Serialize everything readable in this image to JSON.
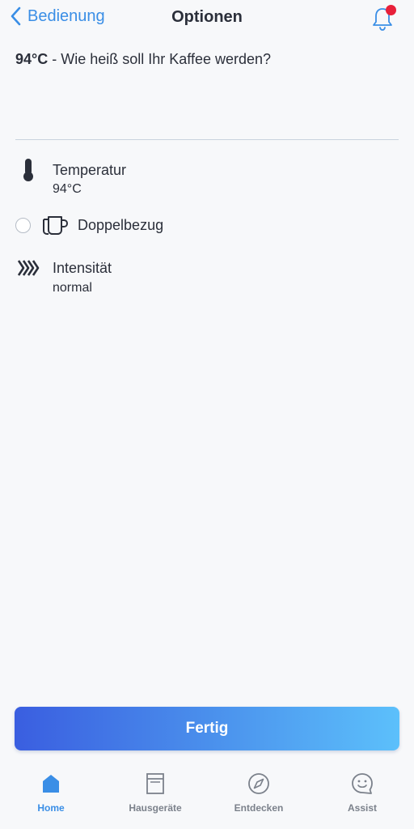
{
  "header": {
    "back_label": "Bedienung",
    "title": "Optionen",
    "notification_dot": true
  },
  "question": {
    "value": "94°C",
    "text": " - Wie heiß soll Ihr Kaffee werden?"
  },
  "options": {
    "temperature": {
      "label": "Temperatur",
      "value": "94°C",
      "icon": "thermometer-icon"
    },
    "double": {
      "label": "Doppelbezug",
      "icon": "double-cup-icon",
      "checked": false
    },
    "intensity": {
      "label": "Intensität",
      "value": "normal",
      "icon": "intensity-arrows-icon"
    }
  },
  "done_button": {
    "label": "Fertig"
  },
  "tabs": [
    {
      "label": "Home",
      "icon": "home-icon",
      "active": true
    },
    {
      "label": "Hausgeräte",
      "icon": "appliance-icon",
      "active": false
    },
    {
      "label": "Entdecken",
      "icon": "compass-icon",
      "active": false
    },
    {
      "label": "Assist",
      "icon": "smiley-chat-icon",
      "active": false
    }
  ],
  "colors": {
    "accent": "#3a8ee6",
    "badge": "#e8203a",
    "button_gradient_start": "#3a5ee0",
    "button_gradient_end": "#5cc0fb"
  }
}
